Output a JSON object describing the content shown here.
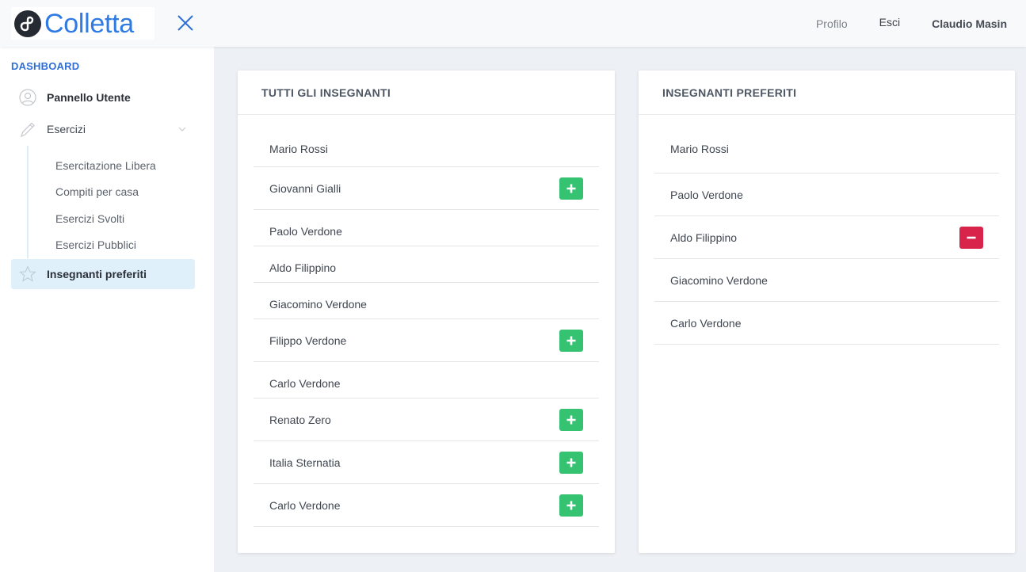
{
  "app": {
    "name": "Colletta"
  },
  "header": {
    "links": [
      "Profilo",
      "Esci"
    ],
    "user": "Claudio Masin"
  },
  "sidebar": {
    "heading": "DASHBOARD",
    "items": [
      {
        "label": "Pannello Utente",
        "icon": "user-circle-icon"
      },
      {
        "label": "Esercizi",
        "icon": "pencil-icon"
      },
      {
        "label": "Insegnanti preferiti",
        "icon": "star-icon"
      }
    ],
    "sub_items": [
      "Esercitazione Libera",
      "Compiti per casa",
      "Esercizi Svolti",
      "Esercizi Pubblici"
    ]
  },
  "all_teachers": {
    "title": "TUTTI GLI INSEGNANTI",
    "rows": [
      {
        "name": "Mario Rossi",
        "action": "none"
      },
      {
        "name": "Giovanni Gialli",
        "action": "add"
      },
      {
        "name": "Paolo Verdone",
        "action": "none"
      },
      {
        "name": "Aldo Filippino",
        "action": "none"
      },
      {
        "name": "Giacomino Verdone",
        "action": "none"
      },
      {
        "name": "Filippo Verdone",
        "action": "add"
      },
      {
        "name": "Carlo Verdone",
        "action": "none"
      },
      {
        "name": "Renato Zero",
        "action": "add"
      },
      {
        "name": "Italia Sternatia",
        "action": "add"
      },
      {
        "name": "Carlo Verdone",
        "action": "add"
      }
    ]
  },
  "favorite_teachers": {
    "title": "INSEGNANTI PREFERITI",
    "rows": [
      {
        "name": "Mario Rossi",
        "action": "none"
      },
      {
        "name": "Paolo Verdone",
        "action": "none"
      },
      {
        "name": "Aldo Filippino",
        "action": "remove"
      },
      {
        "name": "Giacomino Verdone",
        "action": "none"
      },
      {
        "name": "Carlo Verdone",
        "action": "none"
      }
    ]
  },
  "colors": {
    "accent": "#2f7be3",
    "add": "#35c372",
    "remove": "#d8244a",
    "active_bg": "#dff0fb"
  }
}
